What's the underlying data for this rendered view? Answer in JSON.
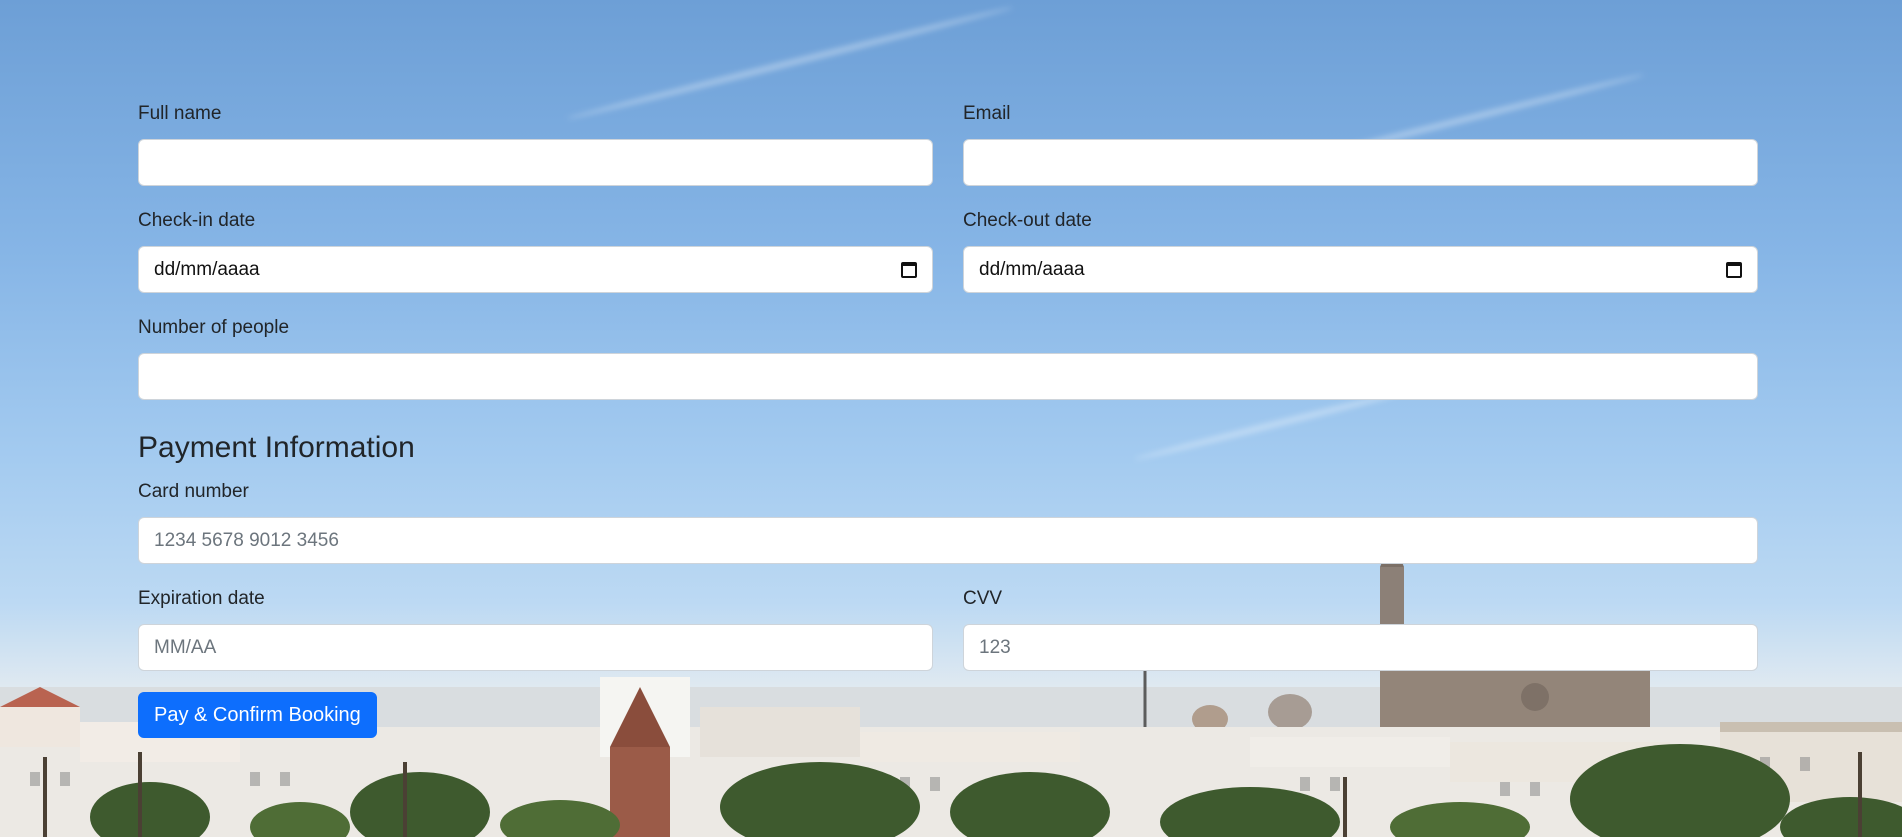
{
  "form": {
    "full_name": {
      "label": "Full name",
      "value": ""
    },
    "email": {
      "label": "Email",
      "value": ""
    },
    "check_in": {
      "label": "Check-in date",
      "value": "dd/mm/aaaa"
    },
    "check_out": {
      "label": "Check-out date",
      "value": "dd/mm/aaaa"
    },
    "people": {
      "label": "Number of people",
      "value": ""
    }
  },
  "payment": {
    "title": "Payment Information",
    "card_number": {
      "label": "Card number",
      "placeholder": "1234 5678 9012 3456"
    },
    "expiration": {
      "label": "Expiration date",
      "placeholder": "MM/AA"
    },
    "cvv": {
      "label": "CVV",
      "placeholder": "123"
    }
  },
  "submit_label": "Pay & Confirm Booking",
  "icons": {
    "date_picker": "calendar-icon"
  },
  "colors": {
    "primary": "#0d6efd",
    "input_border": "#ced4da",
    "text": "#212529",
    "placeholder": "#6c757d"
  }
}
